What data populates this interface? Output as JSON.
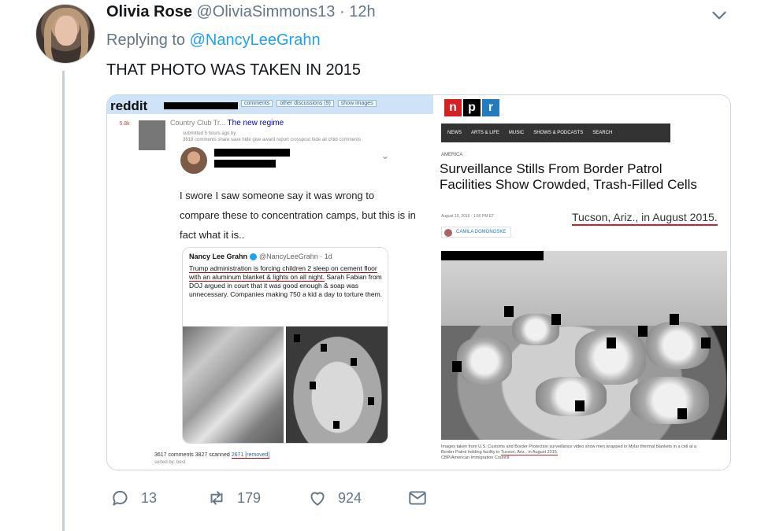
{
  "tweet": {
    "name": "Olivia Rose",
    "handle": "@OliviaSimmons13",
    "separator": "·",
    "time": "12h",
    "replying_prefix": "Replying to",
    "replying_to": "@NancyLeeGrahn",
    "text": "THAT PHOTO WAS TAKEN IN 2015"
  },
  "reddit": {
    "logo": "reddit",
    "tabs": [
      "comments",
      "other discussions (9)",
      "show images"
    ],
    "vote": "5.8k",
    "post_prefix": "Country Club Tr...",
    "post_title": "The new regime",
    "post_meta": "submitted 5 hours ago by",
    "post_links": "3618 comments  share  save  hide  give award  report  crosspost  hide all child comments",
    "quote": "I swore I saw someone say it was wrong to compare these to concentration camps, but this is in fact what it is..",
    "card": {
      "name": "Nancy Lee Grahn",
      "handle": "@NancyLeeGrahn · 1d",
      "underlined_text": "Trump administration is forcing children 2 sleep on cement floor with an aluminum blanket & lights on all night.",
      "rest_text": "Sarah Fabian from DOJ argued in court that it was good enough & soap was unnecessary. Companies making 750 a kid a day to torture them."
    },
    "footer_stats": "3617 comments 3827 scanned",
    "footer_removed": "2671 [removed]",
    "sorted_by": "sorted by: best"
  },
  "npr": {
    "logo": [
      "n",
      "p",
      "r"
    ],
    "nav": [
      "NEWS",
      "ARTS & LIFE",
      "MUSIC",
      "SHOWS & PODCASTS",
      "SEARCH"
    ],
    "category": "AMERICA",
    "title": "Surveillance Stills From Border Patrol Facilities Show Crowded, Trash-Filled Cells",
    "date": "August 19, 2016 · 1:56 PM ET",
    "location_highlight": "Tucson, Ariz., in August 2015.",
    "author": "CAMILA DOMONOSKE",
    "caption_start": "Images taken from U.S. Customs and Border Protection surveillance video show men wrapped in Mylar thermal blankets in a cell at a Border Patrol holding facility in",
    "caption_highlight": "Tucson, Ariz., in August 2015.",
    "caption_credit": "CBP/American Immigration Council"
  },
  "actions": {
    "reply_count": "13",
    "retweet_count": "179",
    "like_count": "924"
  },
  "colors": {
    "link": "#1da1f2",
    "muted": "#657786",
    "thread_line": "#c4cfd6",
    "underline_red": "#cc0000"
  }
}
